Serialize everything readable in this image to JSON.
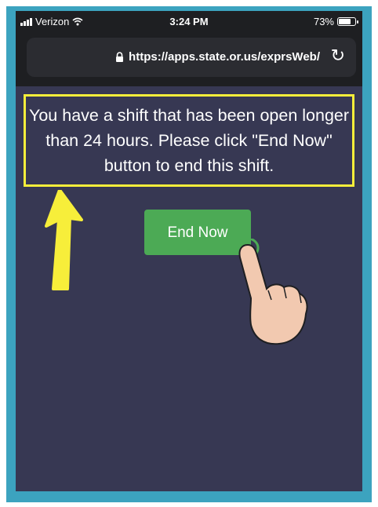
{
  "status_bar": {
    "carrier": "Verizon",
    "time": "3:24 PM",
    "battery": "73%"
  },
  "browser": {
    "url": "https://apps.state.or.us/exprsWeb/"
  },
  "message": {
    "text": "You have a shift that has been open longer than 24 hours. Please click \"End Now\" button to end this shift."
  },
  "end_button": {
    "label": "End Now"
  },
  "colors": {
    "frame": "#3ca3bf",
    "background": "#373853",
    "highlight": "#f7ee3a",
    "button": "#4caa55"
  }
}
